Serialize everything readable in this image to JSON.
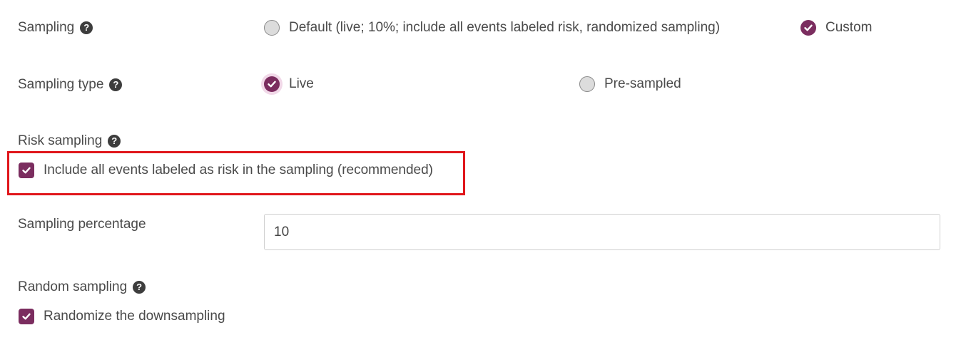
{
  "colors": {
    "accent": "#7b2d5f",
    "highlight_border": "#e0161b"
  },
  "sampling": {
    "label": "Sampling",
    "help_icon": "question-circle-icon",
    "options": [
      {
        "label": "Default (live; 10%; include all events labeled risk, randomized sampling)",
        "selected": false
      },
      {
        "label": "Custom",
        "selected": true
      }
    ]
  },
  "sampling_type": {
    "label": "Sampling type",
    "help_icon": "question-circle-icon",
    "options": [
      {
        "label": "Live",
        "selected": true
      },
      {
        "label": "Pre-sampled",
        "selected": false
      }
    ]
  },
  "risk_sampling": {
    "label": "Risk sampling",
    "help_icon": "question-circle-icon",
    "checkbox_label": "Include all events labeled as risk in the sampling (recommended)",
    "checked": true
  },
  "sampling_percentage": {
    "label": "Sampling percentage",
    "value": "10"
  },
  "random_sampling": {
    "label": "Random sampling",
    "help_icon": "question-circle-icon",
    "checkbox_label": "Randomize the downsampling",
    "checked": true
  }
}
